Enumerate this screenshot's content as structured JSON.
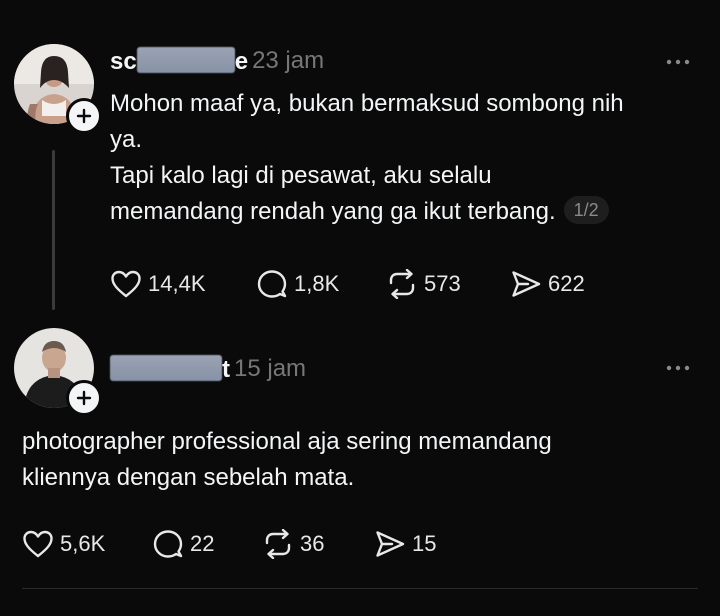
{
  "posts": [
    {
      "username_visible_start": "sc",
      "username_visible_end": "e",
      "time": "23 jam",
      "lines": [
        "Mohon maaf ya, bukan bermaksud sombong nih",
        "ya.",
        "Tapi kalo lagi di pesawat, aku selalu",
        "memandang rendah yang ga ikut terbang."
      ],
      "page_indicator": "1/2",
      "likes": "14,4K",
      "replies": "1,8K",
      "reposts": "573",
      "shares": "622"
    },
    {
      "username_visible_end": "t",
      "time": "15 jam",
      "lines": [
        "photographer professional aja sering memandang",
        "kliennya dengan sebelah mata."
      ],
      "likes": "5,6K",
      "replies": "22",
      "reposts": "36",
      "shares": "15"
    }
  ],
  "icons": {
    "like": "heart-icon",
    "reply": "comment-icon",
    "repost": "repost-icon",
    "share": "send-icon",
    "more": "more-dots-icon",
    "follow": "plus-icon"
  },
  "colors": {
    "background": "#0a0a0a",
    "text": "#f3f5f7",
    "secondary": "#777777",
    "redaction": "#8c97aa"
  }
}
